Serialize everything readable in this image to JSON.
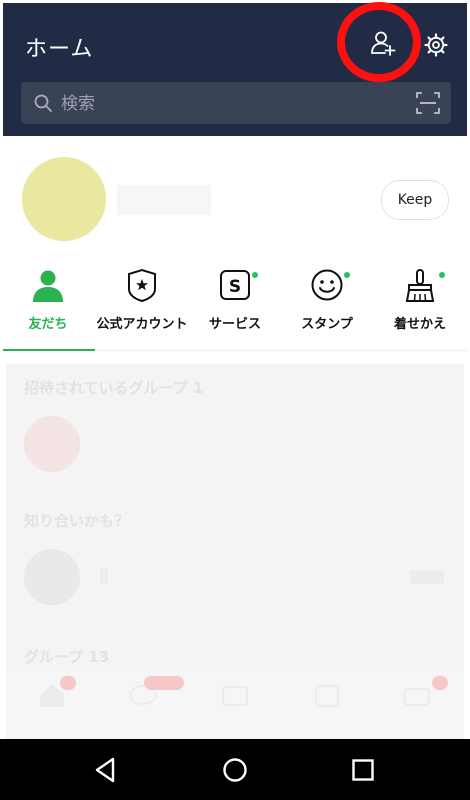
{
  "header": {
    "title": "ホーム",
    "add_friend_icon": "person-add-icon",
    "settings_icon": "gear-icon"
  },
  "search": {
    "placeholder": "検索",
    "scan_icon": "qr-scan-icon"
  },
  "profile": {
    "keep_label": "Keep"
  },
  "service_tabs": [
    {
      "label": "友だち",
      "icon": "person-icon",
      "active": true
    },
    {
      "label": "公式アカウント",
      "icon": "shield-star-icon"
    },
    {
      "label": "サービス",
      "icon": "s-box-icon",
      "new": true
    },
    {
      "label": "スタンプ",
      "icon": "smiley-icon",
      "new": true
    },
    {
      "label": "着せかえ",
      "icon": "brush-icon",
      "new": true
    }
  ],
  "faded_content": {
    "invited_groups": "招待されているグループ 1",
    "people_you_may_know": "知り合いかも？",
    "groups": "グループ 13"
  },
  "colors": {
    "header_bg": "#222b45",
    "accent_green": "#24b34d",
    "highlight_ring": "#ff1010"
  }
}
